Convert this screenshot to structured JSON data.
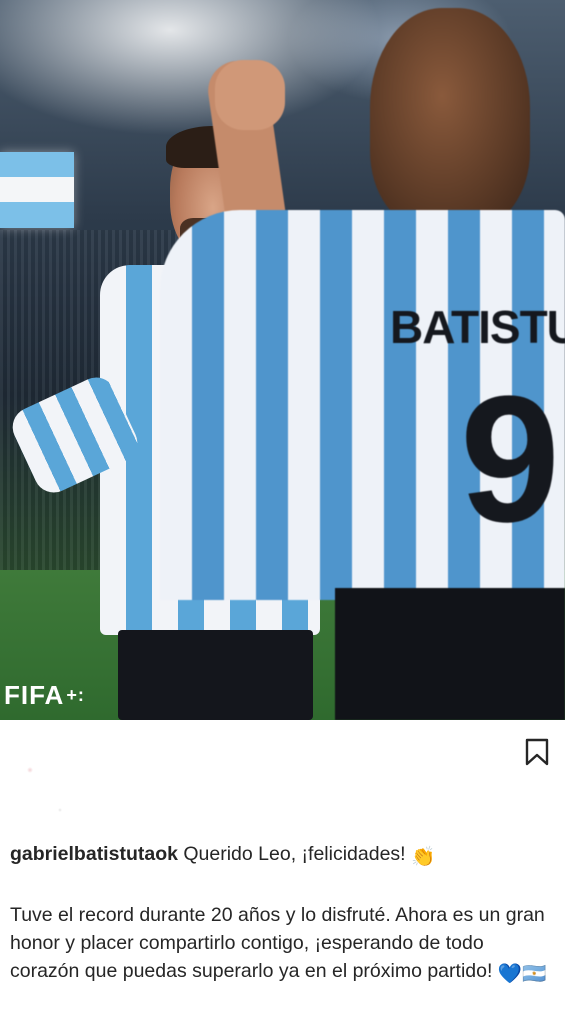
{
  "post": {
    "watermark": "FIFA",
    "watermark_mark": "+:",
    "jersey_name": "BATISTUTA",
    "jersey_number": "9"
  },
  "actions": {
    "bookmark_icon": "bookmark-outline-icon"
  },
  "caption": {
    "username": "gabrielbatistutaok",
    "first_line": "Querido Leo, ¡felicidades!",
    "first_line_emoji": "👏",
    "body": "Tuve el record durante 20 años y lo disfruté.  Ahora es un gran honor y placer compartirlo contigo, ¡esperando de todo corazón que puedas superarlo ya en el próximo partido!",
    "body_emojis": "💙🇦🇷"
  }
}
